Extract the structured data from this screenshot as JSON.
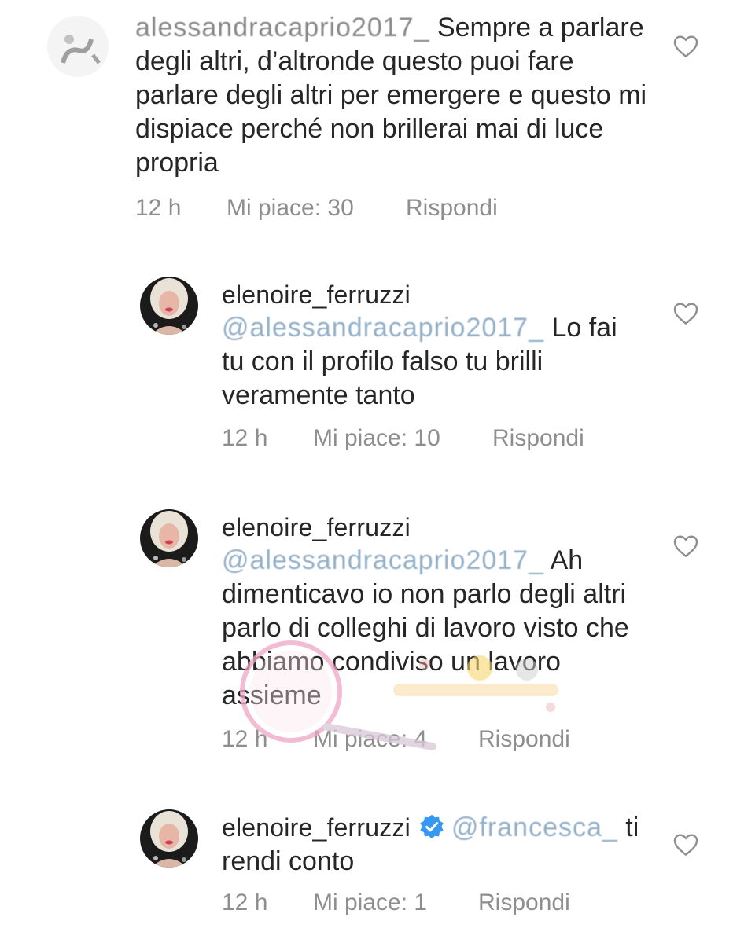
{
  "comments": [
    {
      "username": "alessandracaprio2017_",
      "mention": "",
      "text": "Sempre a parlare degli altri, d’altronde questo puoi fare parlare degli altri per emergere e questo mi dispiace perché non brillerai mai di luce propria",
      "time": "12 h",
      "likes": "Mi piace: 30",
      "reply": "Rispondi",
      "verified": false
    },
    {
      "username": "elenoire_ferruzzi",
      "mention": "@alessandracaprio2017_",
      "text": "Lo fai tu con il profilo falso tu brilli veramente tanto",
      "time": "12 h",
      "likes": "Mi piace: 10",
      "reply": "Rispondi",
      "verified": false
    },
    {
      "username": "elenoire_ferruzzi",
      "mention": "@alessandracaprio2017_",
      "text": "Ah dimenticavo io non parlo degli altri parlo di colleghi di lavoro visto che abbiamo condiviso un lavoro assieme",
      "time": "12 h",
      "likes": "Mi piace: 4",
      "reply": "Rispondi",
      "verified": false
    },
    {
      "username": "elenoire_ferruzzi",
      "mention": "@francesca_",
      "text": "ti rendi conto",
      "time": "12 h",
      "likes": "Mi piace: 1",
      "reply": "Rispondi",
      "verified": true
    }
  ],
  "icons": {
    "like": "heart-outline-icon",
    "verified": "verified-badge-icon"
  },
  "colors": {
    "text": "#262626",
    "meta": "#8e8e8e",
    "mention": "#3c6e9a",
    "verified": "#3897f0"
  }
}
